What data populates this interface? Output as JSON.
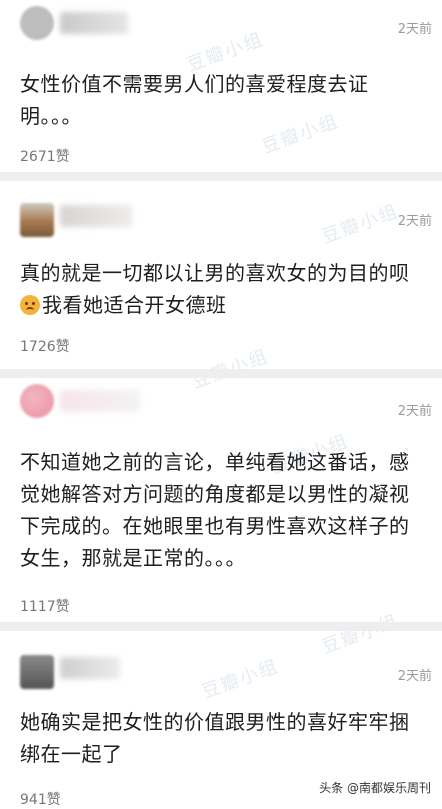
{
  "comments": [
    {
      "time": "2天前",
      "text": "女性价值不需要男人们的喜爱程度去证明。。。",
      "likes": "2671赞"
    },
    {
      "time": "2天前",
      "text_line1": "真的就是一切都以让男的喜欢女的为目的呗",
      "text_line2": "我看她适合开女德班",
      "emoji": "sad-face-emoji",
      "likes": "1726赞"
    },
    {
      "time": "2天前",
      "text": "不知道她之前的言论，单纯看她这番话，感觉她解答对方问题的角度都是以男性的凝视下完成的。在她眼里也有男性喜欢这样子的女生，那就是正常的。。。",
      "likes": "1117赞"
    },
    {
      "time": "2天前",
      "text": "她确实是把女性的价值跟男性的喜好牢牢捆绑在一起了",
      "likes": "941赞"
    }
  ],
  "credit": "头条 @南都娱乐周刊",
  "colors": {
    "separator": "#eeeeee",
    "watermark": "#e4ebf3"
  }
}
